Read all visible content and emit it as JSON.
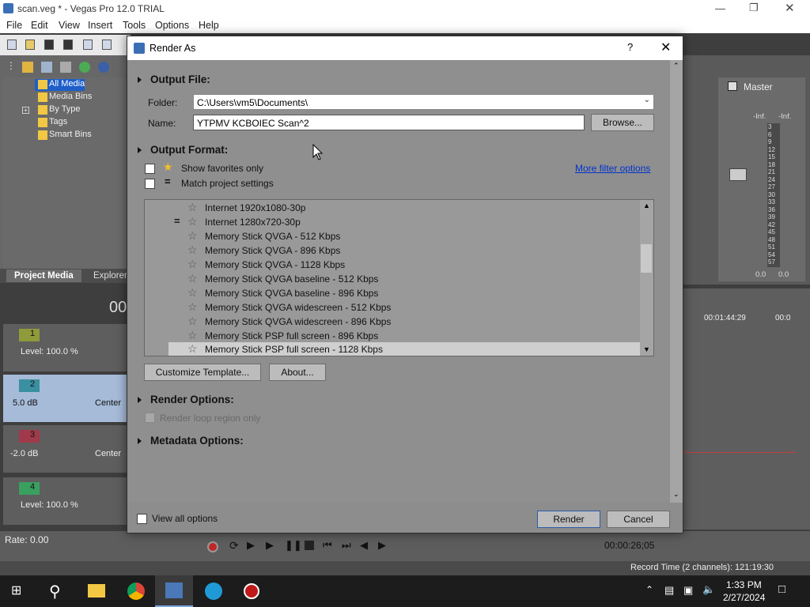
{
  "app": {
    "title": "scan.veg * - Vegas Pro 12.0 TRIAL",
    "menu": [
      "File",
      "Edit",
      "View",
      "Insert",
      "Tools",
      "Options",
      "Help"
    ]
  },
  "media": {
    "tree": [
      "All Media",
      "Media Bins",
      "By Type",
      "Tags",
      "Smart Bins"
    ],
    "tabs": {
      "project_media": "Project Media",
      "explorer": "Explorer"
    }
  },
  "tracks": [
    {
      "num": "1",
      "level": "Level: 100.0 %"
    },
    {
      "num": "2",
      "level": "5.0 dB",
      "pan": "Center"
    },
    {
      "num": "3",
      "level": "-2.0 dB",
      "pan": "Center"
    },
    {
      "num": "4",
      "level": "Level: 100.0 %"
    }
  ],
  "timecode_partial": "00",
  "master": {
    "label": "Master",
    "inf_l": "-Inf.",
    "inf_r": "-Inf.",
    "val_l": "0.0",
    "val_r": "0.0",
    "scale": [
      "3",
      "6",
      "9",
      "12",
      "15",
      "18",
      "21",
      "24",
      "27",
      "30",
      "33",
      "36",
      "39",
      "42",
      "45",
      "48",
      "51",
      "54",
      "57"
    ]
  },
  "ruler": {
    "t1": "00:01:44:29",
    "t2": "00:0"
  },
  "transport": {
    "rate": "Rate: 0.00",
    "time": "00:00:26;05"
  },
  "status": {
    "record_time": "Record Time (2 channels): 121:19:30"
  },
  "dialog": {
    "title": "Render As",
    "help": "?",
    "output_file": "Output File:",
    "folder_label": "Folder:",
    "folder_value": "C:\\Users\\vm5\\Documents\\",
    "name_label": "Name:",
    "name_value": "YTPMV KCBOIEC Scan^2",
    "browse": "Browse...",
    "output_format": "Output Format:",
    "show_favorites": "Show favorites only",
    "match_project": "Match project settings",
    "more_filter": "More filter options",
    "templates": [
      "Internet 1920x1080-30p",
      "Internet 1280x720-30p",
      "Memory Stick QVGA - 512 Kbps",
      "Memory Stick QVGA - 896 Kbps",
      "Memory Stick QVGA - 1128 Kbps",
      "Memory Stick QVGA baseline - 512 Kbps",
      "Memory Stick QVGA baseline - 896 Kbps",
      "Memory Stick QVGA widescreen - 512 Kbps",
      "Memory Stick QVGA widescreen - 896 Kbps",
      "Memory Stick PSP full screen - 896 Kbps",
      "Memory Stick PSP full screen - 1128 Kbps"
    ],
    "customize": "Customize Template...",
    "about": "About...",
    "render_options": "Render Options:",
    "render_loop": "Render loop region only",
    "metadata_options": "Metadata Options:",
    "view_all": "View all options",
    "render": "Render",
    "cancel": "Cancel"
  },
  "taskbar": {
    "time": "1:33 PM",
    "date": "2/27/2024"
  }
}
